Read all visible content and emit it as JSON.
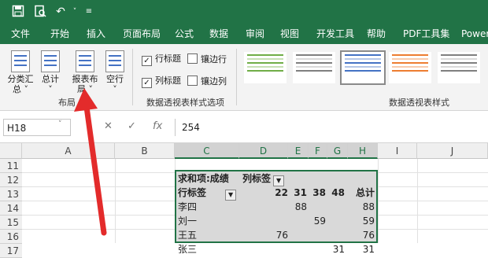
{
  "qat": {
    "icons": [
      "save-icon",
      "print-preview-icon",
      "undo-icon",
      "undo-dropdown-icon",
      "customize-qat-icon"
    ]
  },
  "tabs": [
    "文件",
    "开始",
    "插入",
    "页面布局",
    "公式",
    "数据",
    "审阅",
    "视图",
    "开发工具",
    "帮助",
    "PDF工具集",
    "Power"
  ],
  "ribbon": {
    "layout_group": {
      "label": "布局",
      "buttons": [
        {
          "line1": "分类汇",
          "line2": "总 ˅"
        },
        {
          "line1": "总计",
          "line2": "˅"
        },
        {
          "line1": "报表布",
          "line2": "局 ˅"
        },
        {
          "line1": "空行",
          "line2": "˅"
        }
      ]
    },
    "options_group": {
      "label": "数据透视表样式选项",
      "row_headers": "行标题",
      "col_headers": "列标题",
      "banded_rows": "镶边行",
      "banded_cols": "镶边列",
      "row_headers_checked": true,
      "col_headers_checked": true,
      "banded_rows_checked": false,
      "banded_cols_checked": false
    },
    "styles_group": {
      "label": "数据透视表样式",
      "style_colors": [
        "#70ad47",
        "#7f7f7f",
        "#4472c4",
        "#ed7d31",
        "#7f7f7f"
      ]
    }
  },
  "formula_bar": {
    "name_box": "H18",
    "fx": "fx",
    "cancel": "✕",
    "enter": "✓",
    "value": "254"
  },
  "columns": [
    "A",
    "B",
    "C",
    "D",
    "E",
    "F",
    "G",
    "H",
    "I",
    "J"
  ],
  "rows": [
    "11",
    "12",
    "13",
    "14",
    "15",
    "16",
    "17"
  ],
  "pivot": {
    "title": "求和项:成绩",
    "col_label": "列标签",
    "row_label": "行标签",
    "headers": [
      "22",
      "31",
      "38",
      "48",
      "总计"
    ],
    "data": [
      {
        "name": "李四",
        "values": [
          "",
          "88",
          "",
          "",
          "88"
        ]
      },
      {
        "name": "刘一",
        "values": [
          "",
          "",
          "59",
          "",
          "59"
        ]
      },
      {
        "name": "王五",
        "values": [
          "76",
          "",
          "",
          "",
          "76"
        ]
      },
      {
        "name": "张三",
        "values": [
          "",
          "",
          "",
          "31",
          "31"
        ]
      }
    ]
  },
  "colors": {
    "excel_green": "#217346",
    "arrow_red": "#e32b2b",
    "pivot_fill": "#d9d9d9"
  }
}
